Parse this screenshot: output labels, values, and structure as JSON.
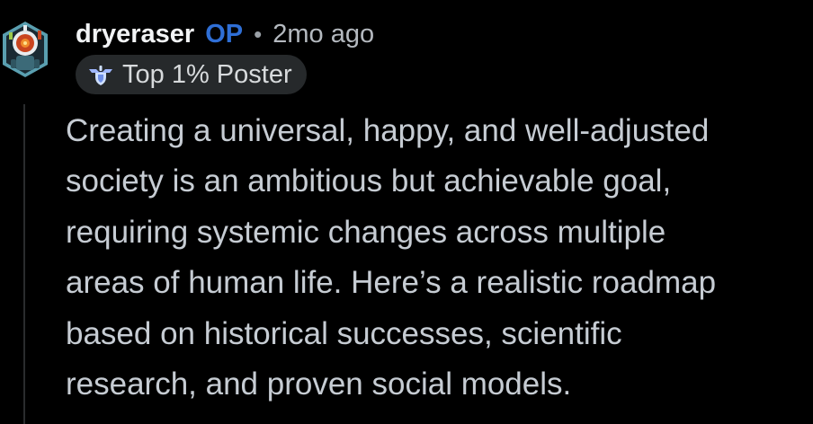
{
  "comment": {
    "username": "dryeraser",
    "op_badge": "OP",
    "separator": "•",
    "timestamp": "2mo ago",
    "flair": {
      "icon": "shield-wings-icon",
      "label": "Top 1% Poster"
    },
    "avatar": {
      "icon": "robot-snoo-avatar-icon"
    },
    "body_lines": [
      "Creating a universal, happy, and well-adjusted",
      "society is an ambitious but achievable goal,",
      "requiring systemic changes across multiple",
      "areas of human life. Here’s a realistic roadmap",
      "based on historical successes, scientific",
      "research, and proven social models."
    ]
  },
  "colors": {
    "background": "#000000",
    "username": "#f1f3f5",
    "op_badge": "#2f6fd6",
    "meta": "#b4b9bf",
    "flair_bg": "#26292b",
    "body_text": "#c6ccd3",
    "thread_line": "#2a2c2e"
  }
}
